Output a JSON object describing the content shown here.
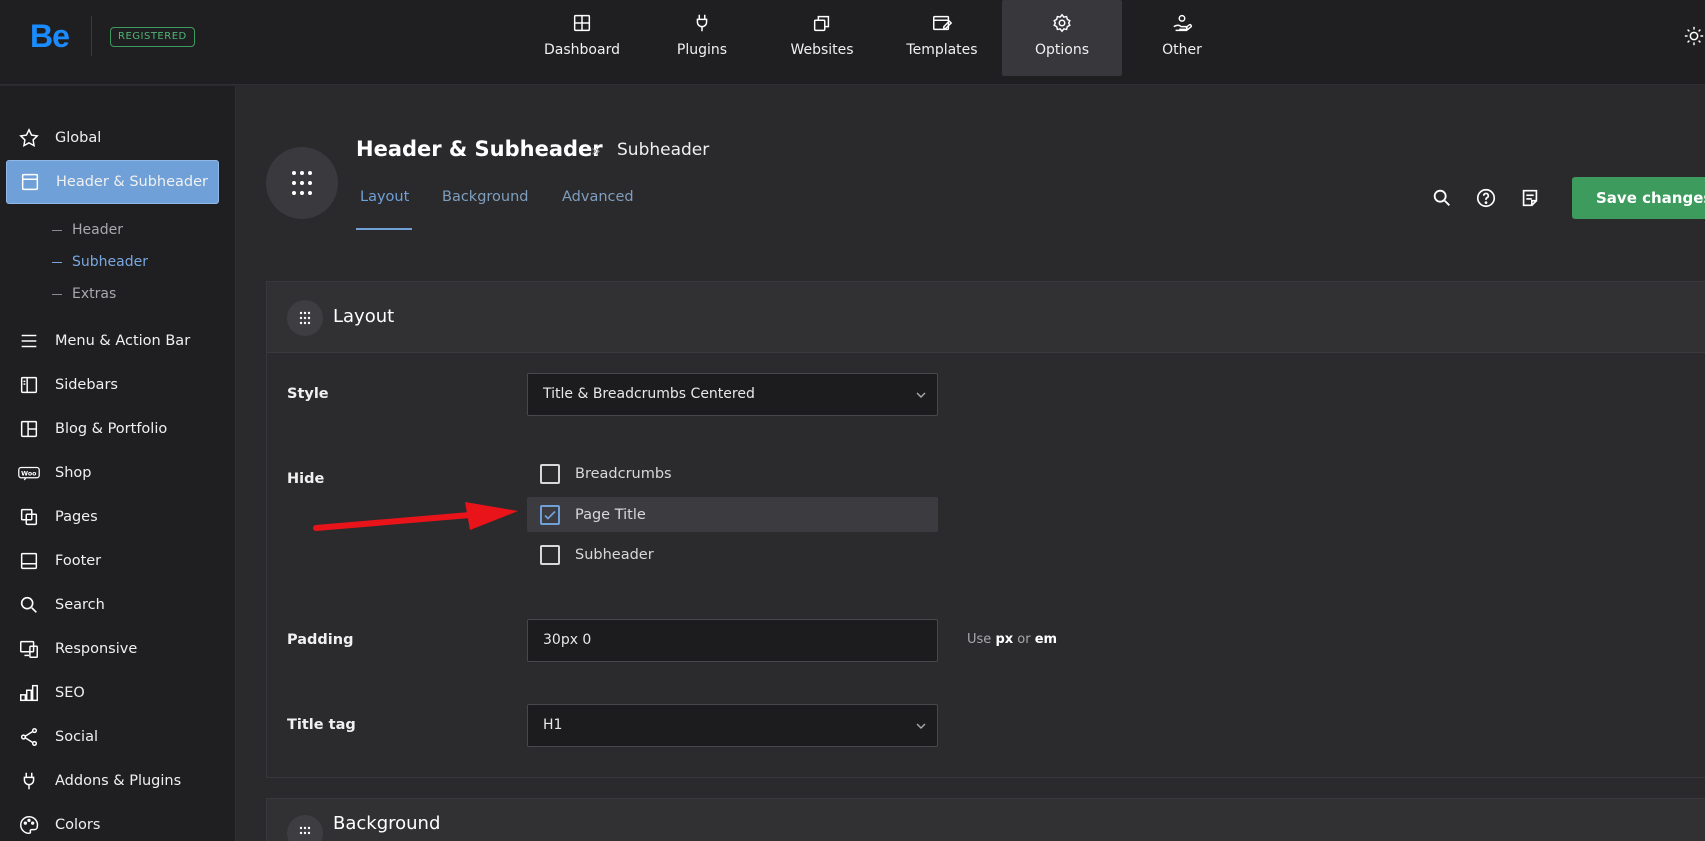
{
  "topbar": {
    "logo": "Be",
    "badge": "REGISTERED",
    "nav": [
      {
        "label": "Dashboard",
        "icon": "layout-icon"
      },
      {
        "label": "Plugins",
        "icon": "plug-icon"
      },
      {
        "label": "Websites",
        "icon": "copy-icon"
      },
      {
        "label": "Templates",
        "icon": "template-edit-icon"
      },
      {
        "label": "Options",
        "icon": "gear-icon",
        "active": true
      },
      {
        "label": "Other",
        "icon": "hand-user-icon"
      }
    ]
  },
  "sidebar": {
    "items": [
      {
        "label": "Global",
        "icon": "star-icon"
      },
      {
        "label": "Header & Subheader",
        "icon": "window-icon",
        "active": true
      },
      {
        "label": "Menu & Action Bar",
        "icon": "menu-icon"
      },
      {
        "label": "Sidebars",
        "icon": "sidebar-icon"
      },
      {
        "label": "Blog & Portfolio",
        "icon": "grid-icon"
      },
      {
        "label": "Shop",
        "icon": "woo-icon"
      },
      {
        "label": "Pages",
        "icon": "pages-icon"
      },
      {
        "label": "Footer",
        "icon": "footer-icon"
      },
      {
        "label": "Search",
        "icon": "search-icon"
      },
      {
        "label": "Responsive",
        "icon": "responsive-icon"
      },
      {
        "label": "SEO",
        "icon": "bars-icon"
      },
      {
        "label": "Social",
        "icon": "share-icon"
      },
      {
        "label": "Addons & Plugins",
        "icon": "plug-icon"
      },
      {
        "label": "Colors",
        "icon": "palette-icon"
      }
    ],
    "sub_items": [
      {
        "label": "Header"
      },
      {
        "label": "Subheader",
        "active": true
      },
      {
        "label": "Extras"
      }
    ]
  },
  "header": {
    "title": "Header & Subheader",
    "separator": "»",
    "breadcrumb": "Subheader",
    "tabs": [
      {
        "label": "Layout",
        "active": true
      },
      {
        "label": "Background"
      },
      {
        "label": "Advanced"
      }
    ],
    "save_label": "Save changes"
  },
  "layout_panel": {
    "title": "Layout",
    "style_label": "Style",
    "style_value": "Title & Breadcrumbs Centered",
    "hide_label": "Hide",
    "hide_options": [
      {
        "label": "Breadcrumbs",
        "checked": false
      },
      {
        "label": "Page Title",
        "checked": true
      },
      {
        "label": "Subheader",
        "checked": false
      }
    ],
    "padding_label": "Padding",
    "padding_value": "30px 0",
    "hint_prefix": "Use",
    "hint_unit1": "px",
    "hint_or": "or",
    "hint_unit2": "em",
    "title_tag_label": "Title tag",
    "title_tag_value": "H1"
  },
  "background_panel": {
    "title": "Background"
  },
  "colors": {
    "accent": "#6fa0d8",
    "save": "#3e9b5e",
    "arrow": "#e8141a"
  }
}
